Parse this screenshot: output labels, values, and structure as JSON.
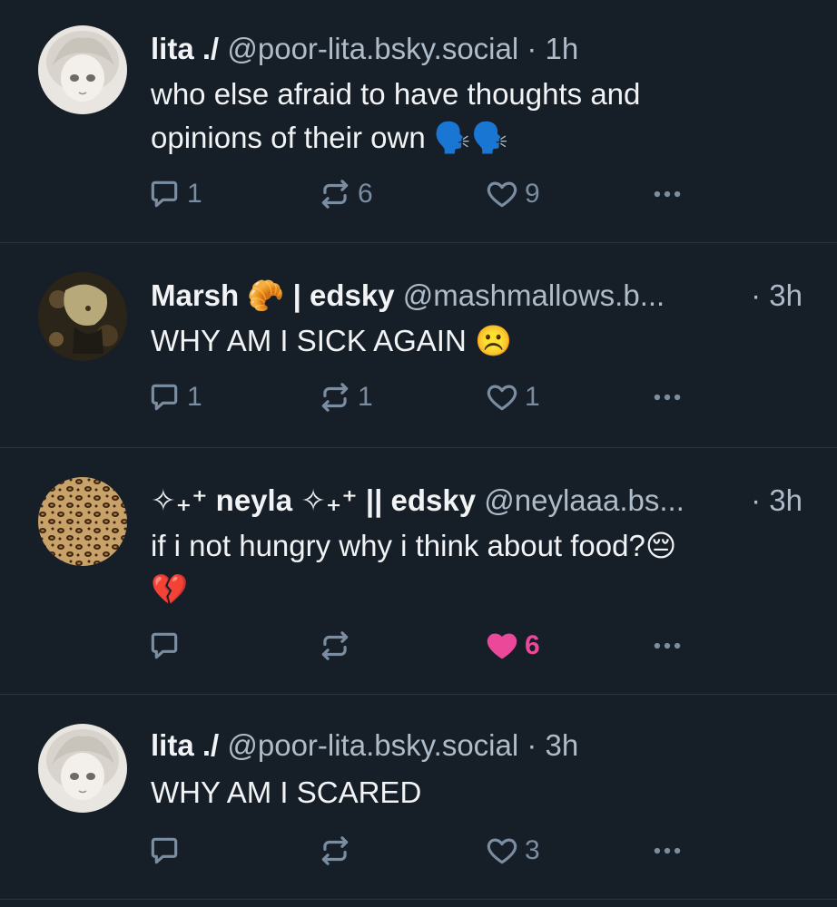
{
  "posts": [
    {
      "display_name": "lita ./",
      "handle": "@poor-lita.bsky.social",
      "time": "· 1h",
      "text_line1": "who else afraid to have thoughts and",
      "text_line2": "opinions of their own 🗣️🗣️",
      "replies": "1",
      "reposts": "6",
      "likes": "9",
      "liked": false,
      "avatar": "pale-haired-anime-character"
    },
    {
      "display_name": "Marsh 🥐",
      "name_suffix": "| edsky",
      "handle": "@mashmallows.b...",
      "time": "· 3h",
      "text_line1": "WHY AM I SICK AGAIN ☹️",
      "replies": "1",
      "reposts": "1",
      "likes": "1",
      "liked": false,
      "avatar": "dark-floral-anime-character"
    },
    {
      "display_name": "✧₊⁺ neyla ✧₊⁺",
      "name_suffix": "|| edsky",
      "handle": "@neylaaa.bs...",
      "time": "· 3h",
      "text_line1": "if i not hungry why i think about food?😔",
      "text_line2": "💔",
      "replies": "",
      "reposts": "",
      "likes": "6",
      "liked": true,
      "avatar": "leopard-print"
    },
    {
      "display_name": "lita ./",
      "handle": "@poor-lita.bsky.social",
      "time": "· 3h",
      "text_line1": "WHY AM I SCARED",
      "replies": "",
      "reposts": "",
      "likes": "3",
      "liked": false,
      "avatar": "pale-haired-anime-character"
    }
  ],
  "icons": {
    "reply": "reply-icon",
    "repost": "repost-icon",
    "like": "heart-icon",
    "more": "more-options-icon"
  },
  "colors": {
    "background": "#161e27",
    "muted": "#7b8da0",
    "liked": "#ec4899"
  }
}
